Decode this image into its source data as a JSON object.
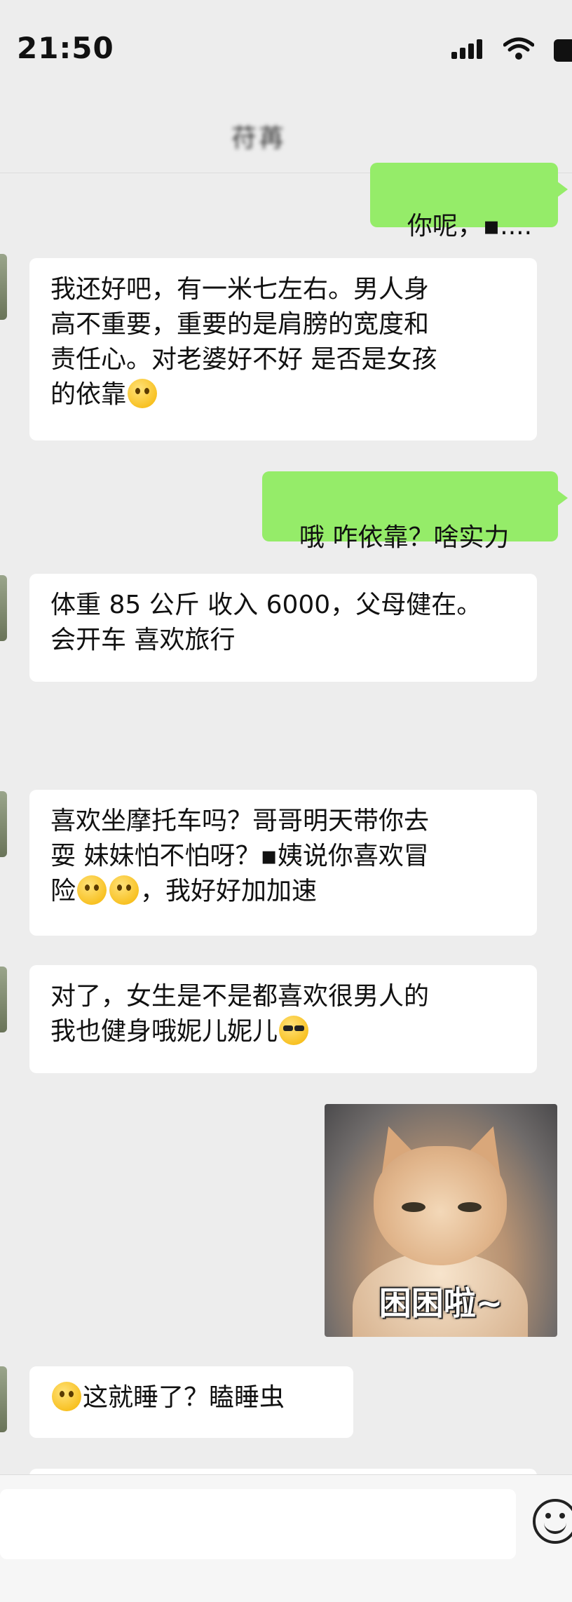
{
  "status_bar": {
    "time": "21:50"
  },
  "header": {
    "contact_name": "苻苒"
  },
  "messages": [
    {
      "side": "out",
      "text": "你呢，▪...."
    },
    {
      "side": "in",
      "text": "我还好吧，有一米七左右。男人身\n高不重要，重要的是肩膀的宽度和\n责任心。对老婆好不好 是否是女孩\n的依靠",
      "emoji": "thinking-face"
    },
    {
      "side": "out",
      "text": "哦 咋依靠？啥实力"
    },
    {
      "side": "in",
      "text": "体重 85 公斤 收入 6000，父母健在。\n会开车 喜欢旅行"
    },
    {
      "side": "in",
      "text_a": "喜欢坐摩托车吗？哥哥明天带你去\n耍 妹妹怕不怕呀？▪姨说你喜欢冒\n险",
      "text_b": "，我好好加加速",
      "emoji": "pleading-face"
    },
    {
      "side": "in",
      "text": "对了，女生是不是都喜欢很男人的\n我也健身哦妮儿妮儿",
      "emoji": "cool-face"
    },
    {
      "side": "out",
      "type": "sticker",
      "caption": "困困啦~"
    },
    {
      "side": "in",
      "text": "这就睡了？瞌睡虫",
      "emoji": "pleading-face"
    }
  ],
  "input_bar": {
    "placeholder": "",
    "emoji_button": "emoji-icon"
  },
  "colors": {
    "background": "#ededed",
    "outgoing_bubble": "#95ec69",
    "incoming_bubble": "#ffffff"
  }
}
